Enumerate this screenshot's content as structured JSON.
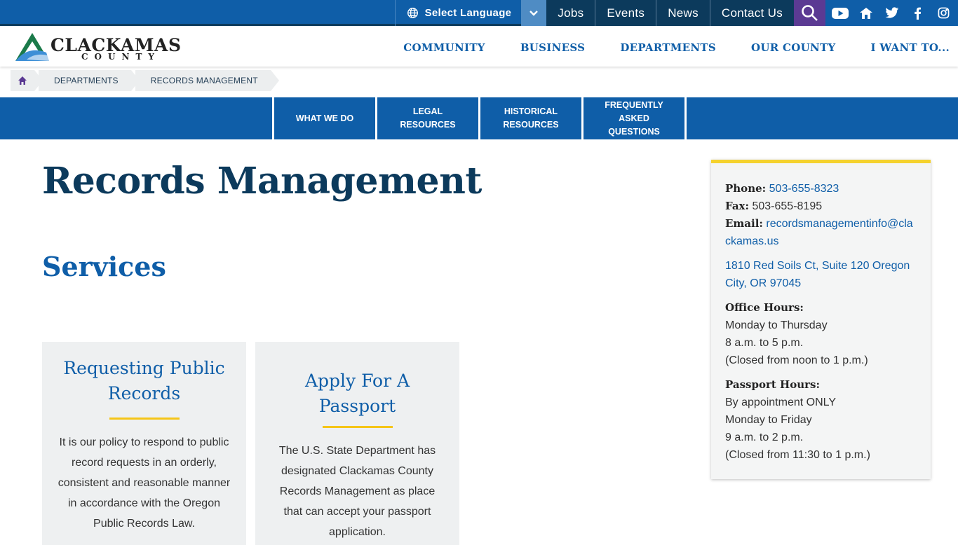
{
  "utility": {
    "language_label": "Select Language",
    "links": [
      "Jobs",
      "Events",
      "News",
      "Contact Us"
    ],
    "social_icons": [
      "youtube-icon",
      "nextdoor-icon",
      "twitter-icon",
      "facebook-icon",
      "instagram-icon"
    ]
  },
  "header": {
    "logo_word1": "CLACKAMAS",
    "logo_word2": "COUNTY",
    "nav": [
      "COMMUNITY",
      "BUSINESS",
      "DEPARTMENTS",
      "OUR COUNTY",
      "I WANT TO..."
    ]
  },
  "breadcrumb": {
    "items": [
      "DEPARTMENTS",
      "RECORDS MANAGEMENT"
    ]
  },
  "subnav": {
    "items": [
      "WHAT WE DO",
      "LEGAL RESOURCES",
      "HISTORICAL RESOURCES",
      "FREQUENTLY ASKED QUESTIONS"
    ]
  },
  "main": {
    "title": "Records Management",
    "section": "Services",
    "cards": [
      {
        "title": "Requesting Public Records",
        "body": "It is our policy to respond to public record requests in an orderly, consistent and reasonable manner in accordance with the Oregon Public Records Law."
      },
      {
        "title": "Apply For A Passport",
        "body": "The U.S. State Department has designated Clackamas County Records Management as place that can accept your passport application."
      }
    ]
  },
  "sidebar": {
    "phone_label": "Phone:",
    "phone": "503-655-8323",
    "fax_label": "Fax:",
    "fax": "503-655-8195",
    "email_label": "Email:",
    "email": "recordsmanagementinfo@clackamas.us",
    "address": "1810 Red Soils Ct, Suite 120 Oregon City, OR 97045",
    "office_label": "Office Hours:",
    "office_lines": [
      "Monday to Thursday",
      "8 a.m. to 5 p.m.",
      "(Closed from noon to 1 p.m.)"
    ],
    "passport_label": "Passport Hours:",
    "passport_lines": [
      "By appointment ONLY",
      "Monday to Friday",
      "9 a.m. to 2 p.m.",
      "(Closed from 11:30 to 1 p.m.)"
    ]
  },
  "colors": {
    "brand_blue": "#0f5ea8",
    "navy": "#0c3a5c",
    "accent_yellow": "#f5c518",
    "search_purple": "#5b3a93"
  }
}
